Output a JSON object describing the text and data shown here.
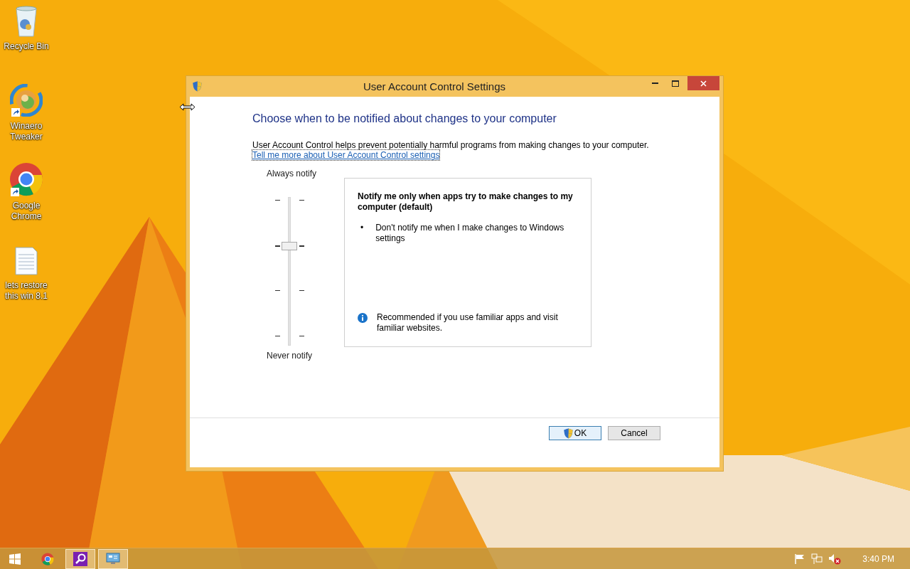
{
  "desktop_icons": [
    {
      "label": "Recycle Bin",
      "kind": "recycle",
      "shortcut": false
    },
    {
      "label": "Winaero Tweaker",
      "kind": "swirl",
      "shortcut": true
    },
    {
      "label": "Google Chrome",
      "kind": "chrome",
      "shortcut": true
    },
    {
      "label": "lets restore this win 8.1",
      "kind": "document",
      "shortcut": false
    }
  ],
  "window": {
    "title": "User Account Control Settings",
    "heading": "Choose when to be notified about changes to your computer",
    "description": "User Account Control helps prevent potentially harmful programs from making changes to your computer.",
    "link": "Tell me more about User Account Control settings",
    "slider": {
      "top_label": "Always notify",
      "bottom_label": "Never notify",
      "level": 0.6667
    },
    "panel": {
      "title": "Notify me only when apps try to make changes to my computer (default)",
      "bullets": [
        {
          "marker": "•",
          "text": "Don't notify me when I make changes to Windows settings"
        }
      ],
      "recommendation": "Recommended if you use familiar apps and visit familiar websites."
    },
    "buttons": [
      {
        "label": "OK",
        "kind": "shield",
        "default": true
      },
      {
        "label": "Cancel",
        "kind": "plain",
        "default": false
      }
    ]
  },
  "taskbar": {
    "items": [
      {
        "kind": "start",
        "active": false
      },
      {
        "kind": "chrome",
        "active": false
      },
      {
        "kind": "search",
        "active": true
      },
      {
        "kind": "uac",
        "active": true
      }
    ],
    "tray": [
      {
        "kind": "flag"
      },
      {
        "kind": "network"
      },
      {
        "kind": "muted"
      }
    ],
    "clock": "3:40 PM"
  }
}
